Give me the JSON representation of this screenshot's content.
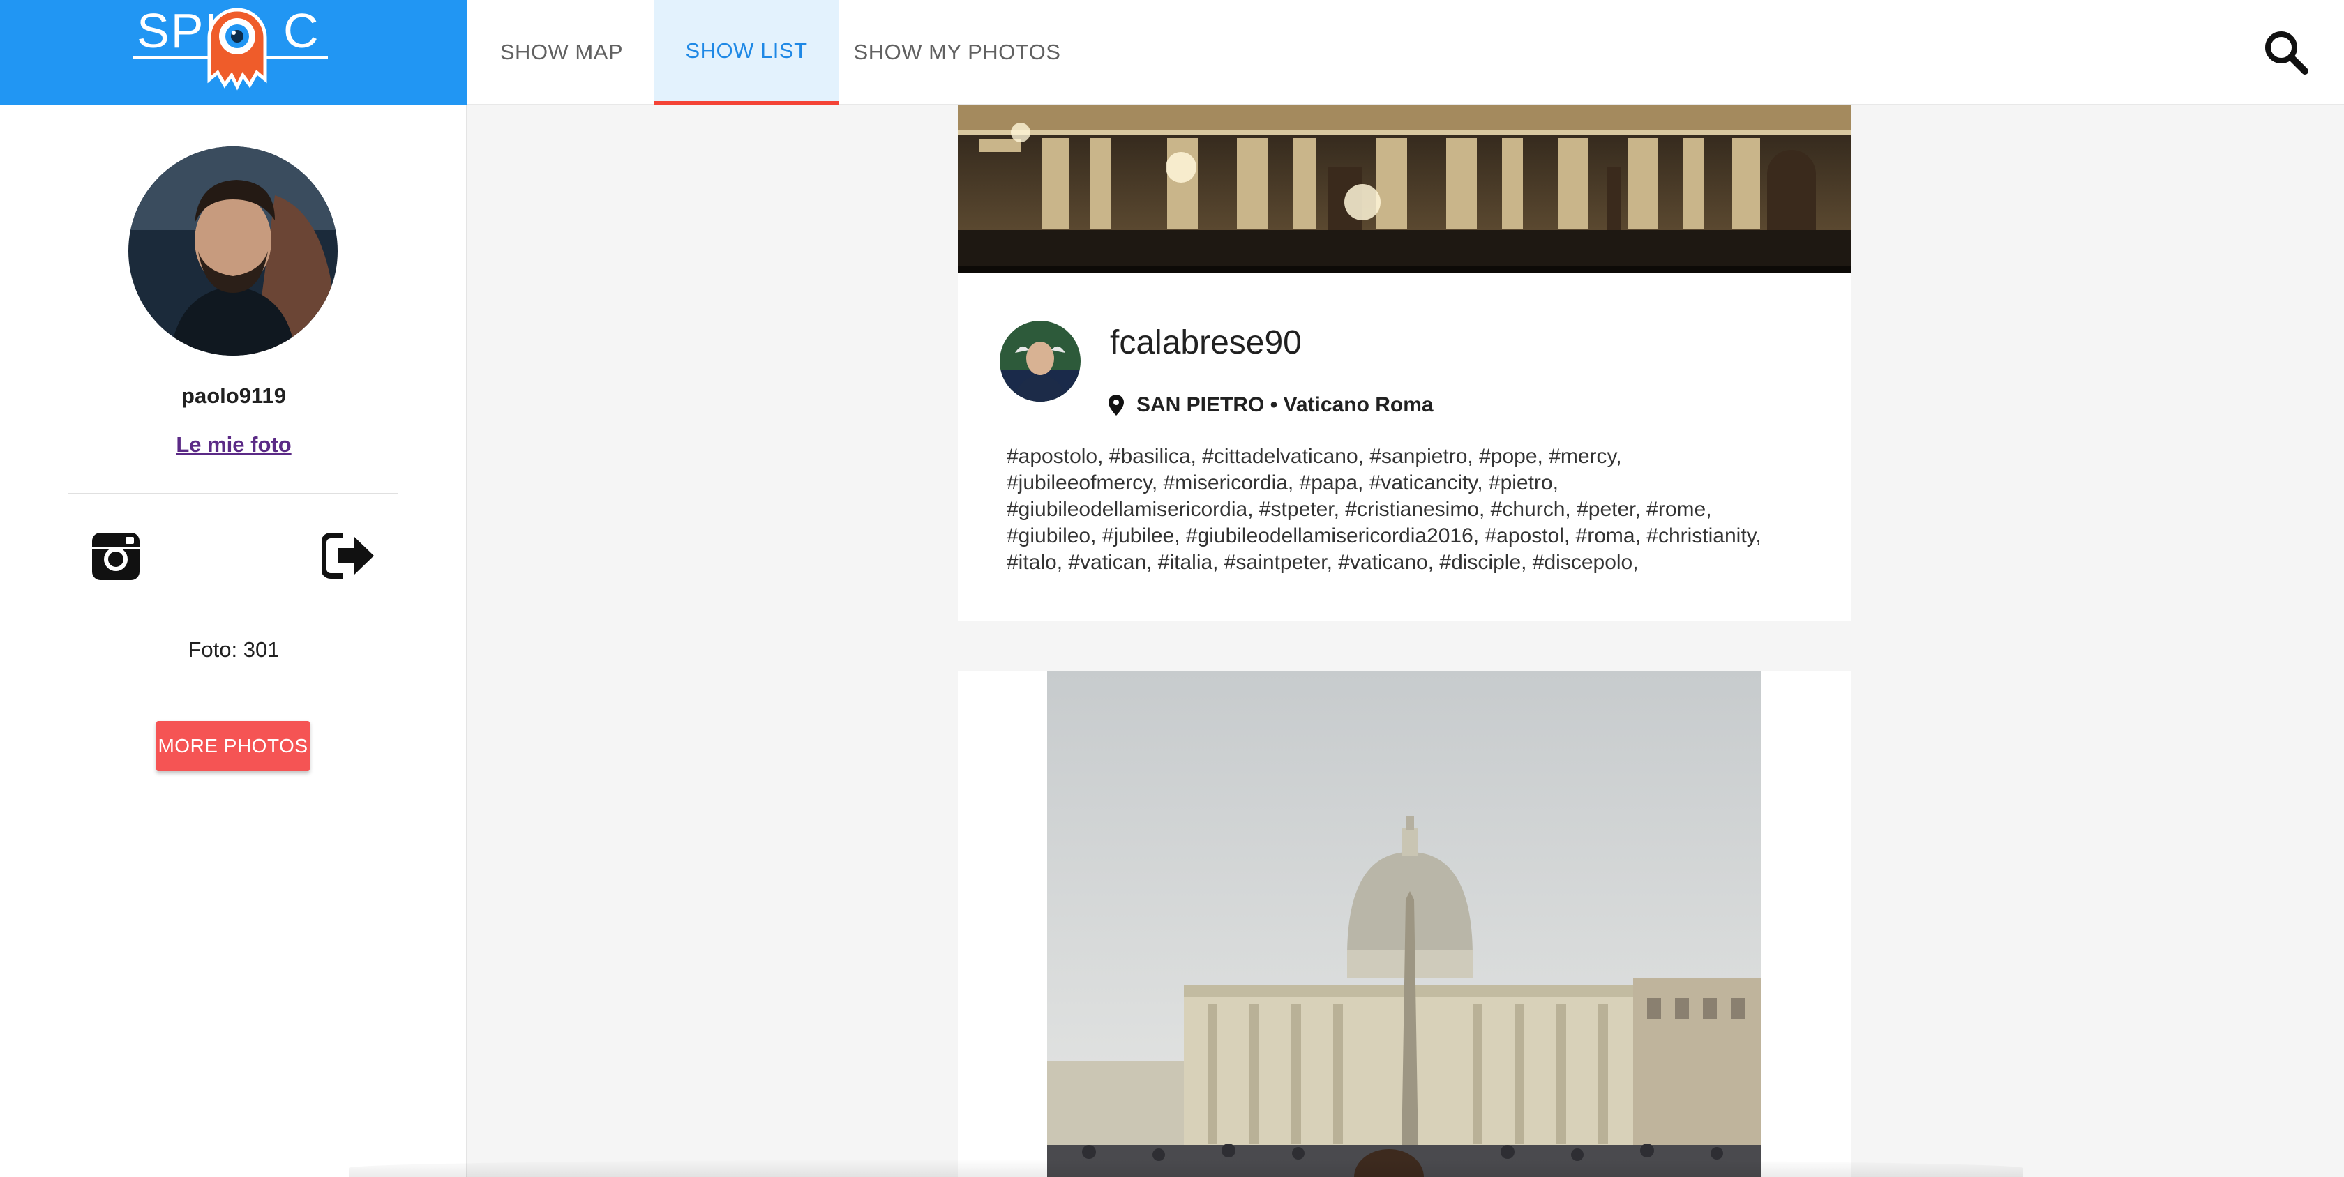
{
  "app": {
    "logo_text": "SPLOC",
    "brand_color": "#2196f3",
    "accent_color": "#f44336"
  },
  "nav": {
    "tabs": [
      {
        "label": "SHOW MAP",
        "active": false
      },
      {
        "label": "SHOW LIST",
        "active": true
      },
      {
        "label": "SHOW MY PHOTOS",
        "active": false
      }
    ],
    "search_icon": "search-icon"
  },
  "sidebar": {
    "username": "paolo9119",
    "my_photos_link": "Le mie foto",
    "instagram_icon": "instagram-icon",
    "logout_icon": "sign-out-icon",
    "photo_count": "Foto: 301",
    "more_button": "MORE PHOTOS"
  },
  "feed": {
    "post": {
      "username": "fcalabrese90",
      "location_icon": "map-marker-icon",
      "location": "SAN PIETRO • Vaticano Roma",
      "tag_lines": [
        "#apostolo, #basilica, #cittadelvaticano, #sanpietro, #pope, #mercy,",
        "#jubileeofmercy, #misericordia, #papa, #vaticancity, #pietro,",
        "#giubileodellamisericordia, #stpeter, #cristianesimo, #church, #peter, #rome,",
        "#giubileo, #jubilee, #giubileodellamisericordia2016, #apostol, #roma, #christianity,",
        "#italo, #vatican, #italia, #saintpeter, #vaticano, #disciple, #discepolo,"
      ]
    }
  }
}
